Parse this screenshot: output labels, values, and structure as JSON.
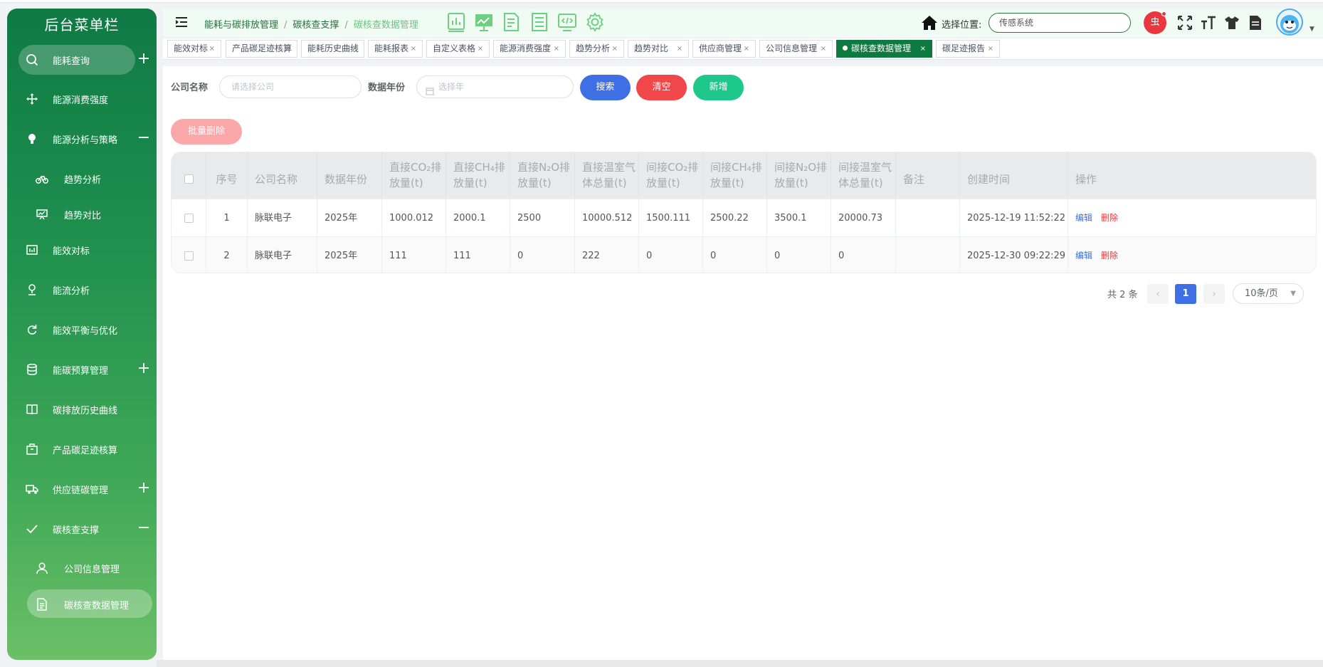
{
  "sidebar": {
    "title": "后台菜单栏",
    "items": [
      {
        "label": "能耗查询",
        "action": "+"
      },
      {
        "label": "能源消费强度"
      },
      {
        "label": "能源分析与策略",
        "action": "−"
      },
      {
        "label": "趋势分析"
      },
      {
        "label": "趋势对比"
      },
      {
        "label": "能效对标"
      },
      {
        "label": "能流分析"
      },
      {
        "label": "能效平衡与优化"
      },
      {
        "label": "能碳预算管理",
        "action": "+"
      },
      {
        "label": "碳排放历史曲线"
      },
      {
        "label": "产品碳足迹核算"
      },
      {
        "label": "供应链碳管理",
        "action": "+"
      },
      {
        "label": "碳核查支撑",
        "action": "−"
      },
      {
        "label": "公司信息管理"
      },
      {
        "label": "碳核查数据管理"
      }
    ]
  },
  "header": {
    "breadcrumb": [
      "能耗与碳排放管理",
      "碳核查支撑",
      "碳核查数据管理"
    ],
    "location_label": "选择位置:",
    "location_value": "传感系统",
    "bug_label": "虫"
  },
  "tabs": [
    "能效对标",
    "产品碳足迹核算",
    "能耗历史曲线",
    "能耗报表",
    "自定义表格",
    "能源消费强度",
    "趋势分析",
    "趋势对比",
    "供应商管理",
    "公司信息管理",
    "碳核查数据管理",
    "碳足迹报告"
  ],
  "active_tab": "碳核查数据管理",
  "filters": {
    "company_label": "公司名称",
    "company_placeholder": "请选择公司",
    "year_label": "数据年份",
    "year_placeholder": "选择年",
    "search": "搜索",
    "clear": "清空",
    "add": "新增",
    "batch_delete": "批量删除"
  },
  "table": {
    "columns": [
      "序号",
      "公司名称",
      "数据年份",
      "直接CO₂排放量(t)",
      "直接CH₄排放量(t)",
      "直接N₂O排放量(t)",
      "直接温室气体总量(t)",
      "间接CO₂排放量(t)",
      "间接CH₄排放量(t)",
      "间接N₂O排放量(t)",
      "间接温室气体总量(t)",
      "备注",
      "创建时间",
      "操作"
    ],
    "rows": [
      {
        "no": "1",
        "company": "脉联电子",
        "year": "2025年",
        "d_co2": "1000.012",
        "d_ch4": "2000.1",
        "d_n2o": "2500",
        "d_total": "10000.512",
        "i_co2": "1500.111",
        "i_ch4": "2500.22",
        "i_n2o": "3500.1",
        "i_total": "20000.73",
        "note": "",
        "created": "2025-12-19 11:52:22",
        "edit": "编辑",
        "del": "删除"
      },
      {
        "no": "2",
        "company": "脉联电子",
        "year": "2025年",
        "d_co2": "111",
        "d_ch4": "111",
        "d_n2o": "0",
        "d_total": "222",
        "i_co2": "0",
        "i_ch4": "0",
        "i_n2o": "0",
        "i_total": "0",
        "note": "",
        "created": "2025-12-30 09:22:29",
        "edit": "编辑",
        "del": "删除"
      }
    ]
  },
  "pagination": {
    "total_text": "共 2 条",
    "current_page": "1",
    "page_size": "10条/页"
  },
  "colors": {
    "sidebar_top": "#0f7a44",
    "sidebar_bottom": "#6cc067",
    "active_tab": "#0d7a40",
    "search": "#3e6fe5",
    "clear": "#f2474a",
    "add": "#1ec88a",
    "batch_delete": "#f9a7a9"
  }
}
